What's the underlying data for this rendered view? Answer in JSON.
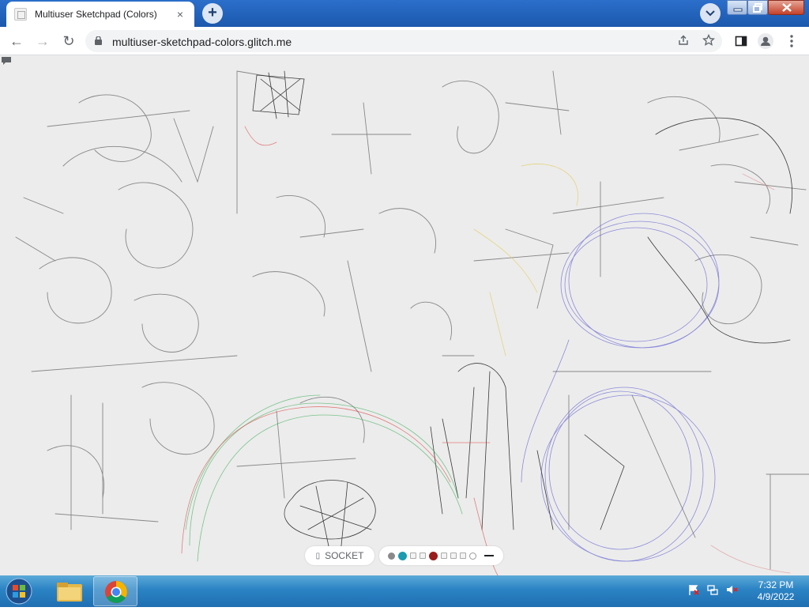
{
  "browser": {
    "tab_title": "Multiuser Sketchpad (Colors)",
    "tab_close": "×",
    "new_tab": "+",
    "url": "multiuser-sketchpad-colors.glitch.me"
  },
  "nav": {
    "back": "←",
    "forward": "→",
    "reload": "↻"
  },
  "sketchpad": {
    "connection_label": "SOCKET",
    "connection_icon": "bolt-icon",
    "palette": [
      {
        "name": "gray",
        "color": "#8a8a8a",
        "shape": "dot"
      },
      {
        "name": "teal",
        "color": "#1a9bb0",
        "shape": "dot-big"
      },
      {
        "name": "light-square-1",
        "color": "#f4f4f4",
        "shape": "square"
      },
      {
        "name": "light-square-2",
        "color": "#f4f4f4",
        "shape": "square"
      },
      {
        "name": "dark-red",
        "color": "#9b1c1c",
        "shape": "dot-big"
      },
      {
        "name": "light-square-3",
        "color": "#f4f4f4",
        "shape": "square"
      },
      {
        "name": "light-square-4",
        "color": "#f4f4f4",
        "shape": "square"
      },
      {
        "name": "light-square-5",
        "color": "#f4f4f4",
        "shape": "square"
      },
      {
        "name": "white",
        "color": "#ffffff",
        "shape": "ring"
      }
    ],
    "stroke_width_icon": "line-icon"
  },
  "taskbar": {
    "time": "7:32 PM",
    "date": "4/9/2022"
  }
}
